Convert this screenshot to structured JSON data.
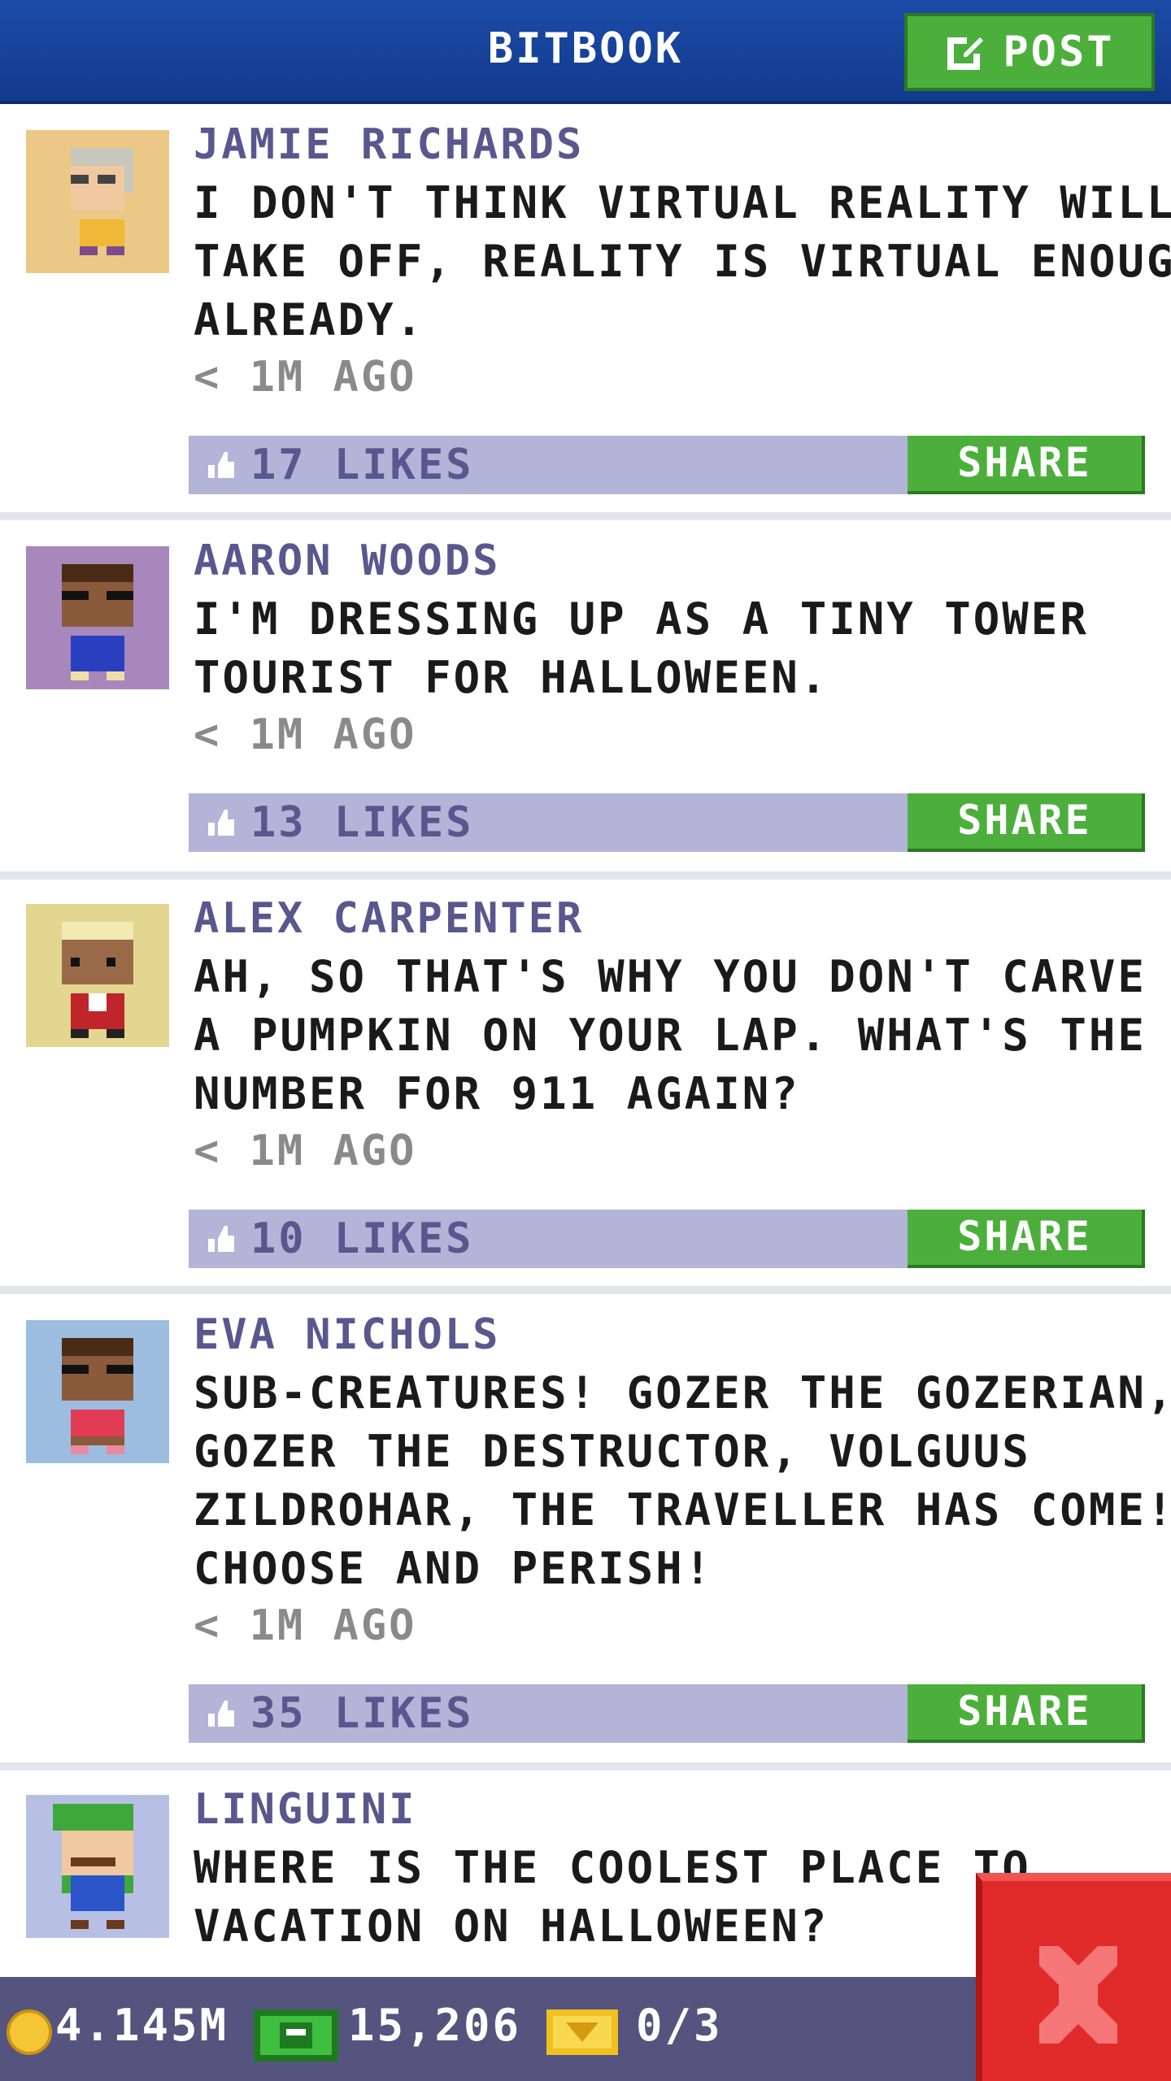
{
  "header": {
    "title": "BITBOOK",
    "post_label": "POST"
  },
  "posts": [
    {
      "name": "JAMIE RICHARDS",
      "lines": [
        "I DON'T THINK VIRTUAL REALITY WILL",
        "TAKE OFF, REALITY IS VIRTUAL ENOUGH",
        "ALREADY."
      ],
      "time": "< 1M AGO",
      "likes": "17 LIKES",
      "share": "SHARE",
      "avatar_bg": "#ecc886"
    },
    {
      "name": "AARON WOODS",
      "lines": [
        "I'M DRESSING UP AS A TINY TOWER",
        "TOURIST FOR HALLOWEEN."
      ],
      "time": "< 1M AGO",
      "likes": "13 LIKES",
      "share": "SHARE",
      "avatar_bg": "#a887bc"
    },
    {
      "name": "ALEX CARPENTER",
      "lines": [
        "AH, SO THAT'S WHY YOU DON'T CARVE",
        "A PUMPKIN ON YOUR LAP. WHAT'S THE",
        "NUMBER FOR 911 AGAIN?"
      ],
      "time": "< 1M AGO",
      "likes": "10 LIKES",
      "share": "SHARE",
      "avatar_bg": "#e2d690"
    },
    {
      "name": "EVA NICHOLS",
      "lines": [
        "SUB-CREATURES! GOZER THE GOZERIAN,",
        "GOZER THE DESTRUCTOR, VOLGUUS",
        "ZILDROHAR, THE TRAVELLER HAS COME!",
        "CHOOSE AND PERISH!"
      ],
      "time": "< 1M AGO",
      "likes": "35 LIKES",
      "share": "SHARE",
      "avatar_bg": "#9cbde0"
    },
    {
      "name": "LINGUINI",
      "lines": [
        "WHERE IS THE COOLEST PLACE TO",
        "VACATION ON HALLOWEEN?"
      ],
      "avatar_bg": "#b7c0e4"
    }
  ],
  "footer": {
    "coins": "4.145M",
    "bux": "15,206",
    "tickets": "0/3"
  },
  "colors": {
    "accent_green": "#4caf3c",
    "header_blue": "#1b4ba8",
    "like_bar": "#b4b4d8",
    "name_purple": "#58588e",
    "close_red": "#e12a2a"
  }
}
